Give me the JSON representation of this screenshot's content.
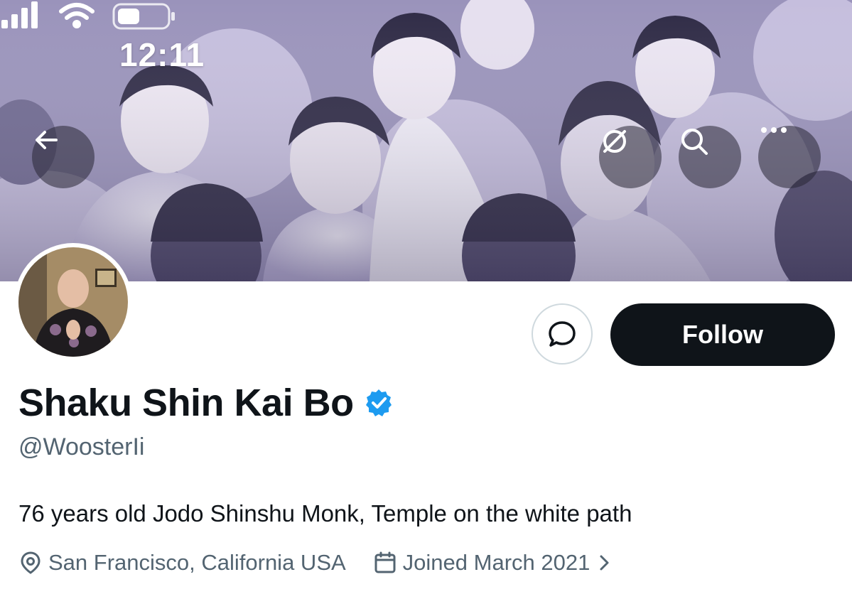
{
  "status_bar": {
    "time": "12:11"
  },
  "banner": {
    "back_button_icon": "arrow-left-icon",
    "grok_button_icon": "grok-icon",
    "search_button_icon": "search-icon",
    "more_button_icon": "more-dots-icon"
  },
  "profile": {
    "display_name": "Shaku Shin Kai Bo",
    "handle": "@WoosterIi",
    "verified": true,
    "bio": "76 years old Jodo Shinshu Monk, Temple on the white path",
    "location": "San Francisco, California USA",
    "joined": "Joined March 2021"
  },
  "actions": {
    "message_icon": "message-bubble-icon",
    "follow_label": "Follow"
  },
  "colors": {
    "primary_text": "#0f1419",
    "secondary_text": "#536471",
    "verified_blue": "#1d9bf0",
    "follow_bg": "#0f1419",
    "border": "#cfd9de"
  }
}
